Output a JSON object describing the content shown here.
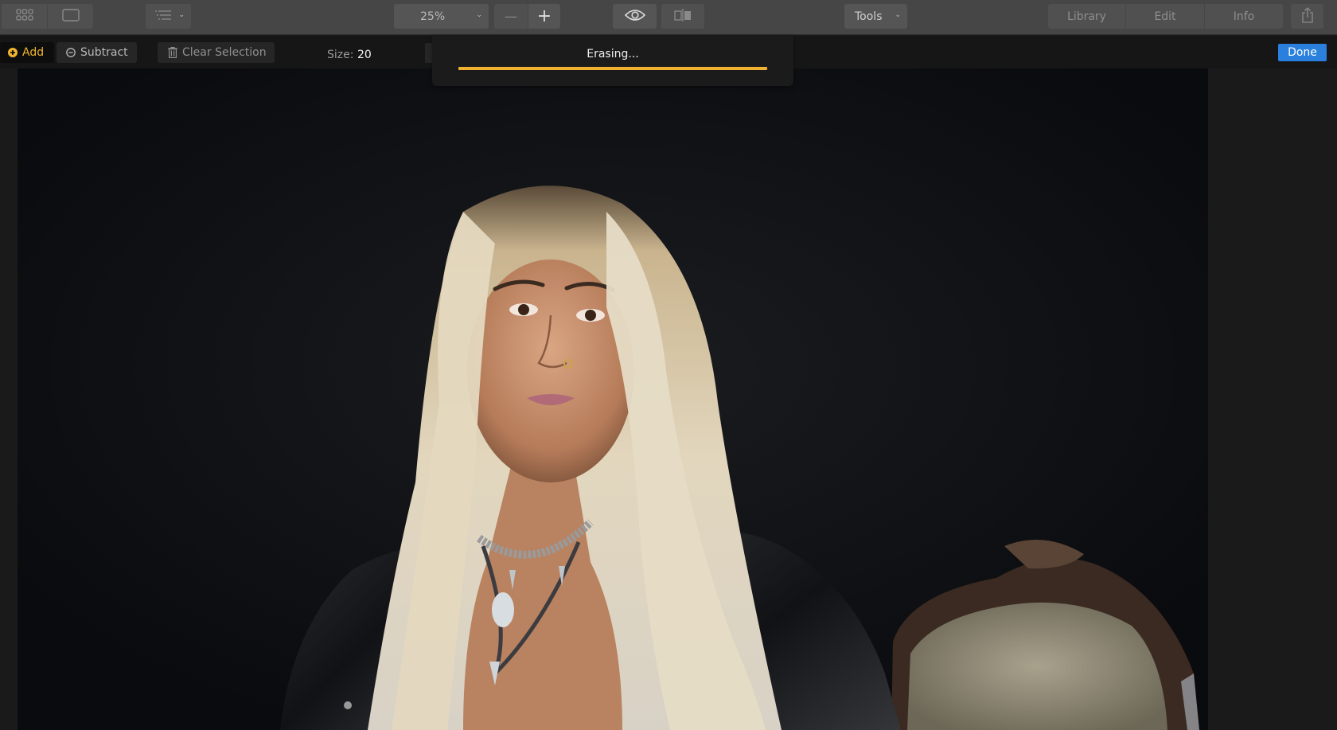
{
  "toolbar": {
    "view_grid_icon": "grid-icon",
    "view_single_icon": "single-view-icon",
    "sort_icon": "list-sort-icon",
    "zoom_value": "25%",
    "zoom_out_label": "—",
    "zoom_in_label": "+",
    "preview_icon": "eye-icon",
    "compare_icon": "compare-split-icon",
    "tools_label": "Tools",
    "nav_tabs": [
      {
        "label": "Library"
      },
      {
        "label": "Edit"
      },
      {
        "label": "Info"
      }
    ],
    "share_icon": "share-icon"
  },
  "erase_bar": {
    "add_label": "Add",
    "subtract_label": "Subtract",
    "clear_label": "Clear Selection",
    "size_label": "Size:",
    "size_value": "20",
    "done_label": "Done"
  },
  "progress_popover": {
    "message": "Erasing...",
    "progress_percent": 100
  },
  "colors": {
    "accent": "#f0b030",
    "done_blue": "#2a80dc",
    "topbar": "#464646",
    "subbar": "#161616"
  },
  "photo": {
    "description": "Portrait of a blonde woman in a black leather jacket with a statement necklace, seated beside an ornate carved chair against a dark backdrop"
  }
}
